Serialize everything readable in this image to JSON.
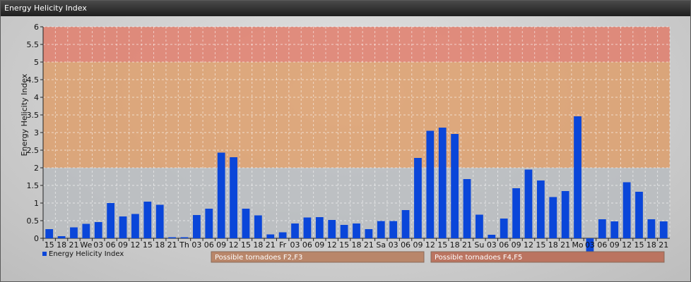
{
  "window": {
    "title": "Energy Helicity Index"
  },
  "chart_data": {
    "type": "bar",
    "ylabel": "Energy Helicity Index",
    "xlabel": "",
    "ylim": [
      0,
      6
    ],
    "yticks": [
      "0",
      "0.5",
      "1",
      "1.5",
      "2",
      "2.5",
      "3",
      "3.5",
      "4",
      "4.5",
      "5",
      "5.5",
      "6"
    ],
    "grid": true,
    "colors": {
      "bar": "#0a46d9",
      "zone_low": "#b9bcc0",
      "zone_mid": "#dd9f6c",
      "zone_high": "#e07e6c"
    },
    "zones": [
      {
        "from": 0,
        "to": 2,
        "color": "#b9bcc0"
      },
      {
        "from": 2,
        "to": 5,
        "color": "#dd9f6c"
      },
      {
        "from": 5,
        "to": 6,
        "color": "#e07e6c"
      }
    ],
    "categories": [
      "15",
      "18",
      "21",
      "We",
      "03",
      "06",
      "09",
      "12",
      "15",
      "18",
      "21",
      "Th",
      "03",
      "06",
      "09",
      "12",
      "15",
      "18",
      "21",
      "Fr",
      "03",
      "06",
      "09",
      "12",
      "15",
      "18",
      "21",
      "Sa",
      "03",
      "06",
      "09",
      "12",
      "15",
      "18",
      "21",
      "Su",
      "03",
      "06",
      "09",
      "12",
      "15",
      "18",
      "21",
      "Mo",
      "03",
      "06",
      "09",
      "12",
      "15",
      "18",
      "21"
    ],
    "series": [
      {
        "name": "Energy Helicity Index",
        "values": [
          0.26,
          0.06,
          0.31,
          0.41,
          0.46,
          1.0,
          0.62,
          0.69,
          1.04,
          0.95,
          0.03,
          0.03,
          0.66,
          0.84,
          2.43,
          2.3,
          0.84,
          0.65,
          0.11,
          0.17,
          0.42,
          0.59,
          0.6,
          0.52,
          0.38,
          0.42,
          0.26,
          0.49,
          0.49,
          0.8,
          2.28,
          3.05,
          3.14,
          2.96,
          1.68,
          0.67,
          0.1,
          0.56,
          1.42,
          1.95,
          1.64,
          1.17,
          1.34,
          3.46,
          -0.44,
          0.54,
          0.48,
          1.59,
          1.32,
          0.54,
          0.48
        ]
      }
    ],
    "legend": {
      "placement": "bottom-left",
      "label": "Energy Helicity Index"
    },
    "annotations": [
      {
        "label": "Possible tornadoes F2,F3",
        "color": "#b9866a"
      },
      {
        "label": "Possible tornadoes F4,F5",
        "color": "#bb7460"
      }
    ]
  }
}
